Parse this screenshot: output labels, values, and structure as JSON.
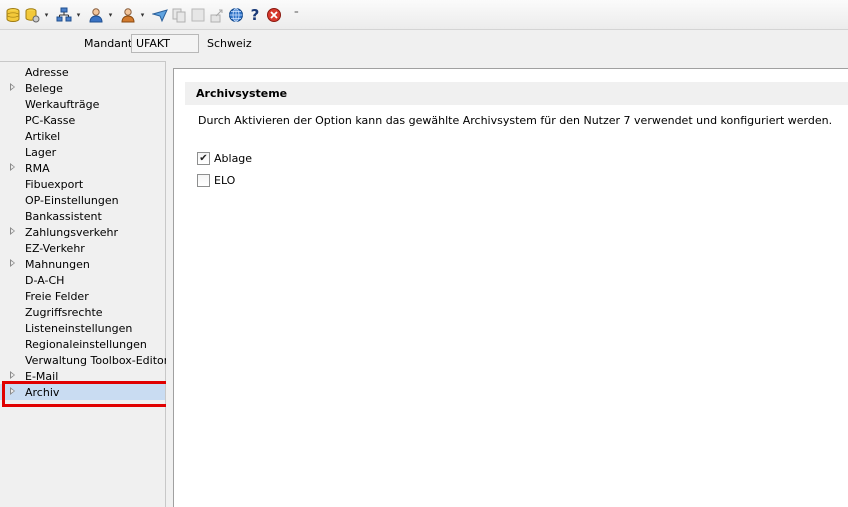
{
  "toolbar": {
    "icons": [
      "database-icon",
      "database-settings-icon",
      "org-chart-icon",
      "user-icon",
      "user-group-icon",
      "send-icon",
      "copy-icon",
      "blank-icon",
      "export-icon",
      "globe-icon",
      "help-icon",
      "close-icon"
    ],
    "overflow": "⁼"
  },
  "mandant": {
    "label": "Mandant",
    "value": "UFAKT",
    "country": "Schweiz"
  },
  "sidebar": {
    "items": [
      {
        "label": "Adresse",
        "expandable": false
      },
      {
        "label": "Belege",
        "expandable": true
      },
      {
        "label": "Werkaufträge",
        "expandable": false
      },
      {
        "label": "PC-Kasse",
        "expandable": false
      },
      {
        "label": "Artikel",
        "expandable": false
      },
      {
        "label": "Lager",
        "expandable": false
      },
      {
        "label": "RMA",
        "expandable": true
      },
      {
        "label": "Fibuexport",
        "expandable": false
      },
      {
        "label": "OP-Einstellungen",
        "expandable": false
      },
      {
        "label": "Bankassistent",
        "expandable": false
      },
      {
        "label": "Zahlungsverkehr",
        "expandable": true
      },
      {
        "label": "EZ-Verkehr",
        "expandable": false
      },
      {
        "label": "Mahnungen",
        "expandable": true
      },
      {
        "label": "D-A-CH",
        "expandable": false
      },
      {
        "label": "Freie Felder",
        "expandable": false
      },
      {
        "label": "Zugriffsrechte",
        "expandable": false
      },
      {
        "label": "Listeneinstellungen",
        "expandable": false
      },
      {
        "label": "Regionaleinstellungen",
        "expandable": false
      },
      {
        "label": "Verwaltung Toolbox-Editor",
        "expandable": false
      },
      {
        "label": "E-Mail",
        "expandable": true
      },
      {
        "label": "Archiv",
        "expandable": true,
        "selected": true
      }
    ]
  },
  "main": {
    "section_title": "Archivsysteme",
    "description": "Durch Aktivieren der Option kann das gewählte Archivsystem für den Nutzer  7 verwendet und konfiguriert werden.",
    "options": [
      {
        "label": "Ablage",
        "checked": true
      },
      {
        "label": "ELO",
        "checked": false
      }
    ]
  },
  "colors": {
    "selection": "#c9dcf2",
    "highlight_border": "#e00000"
  }
}
